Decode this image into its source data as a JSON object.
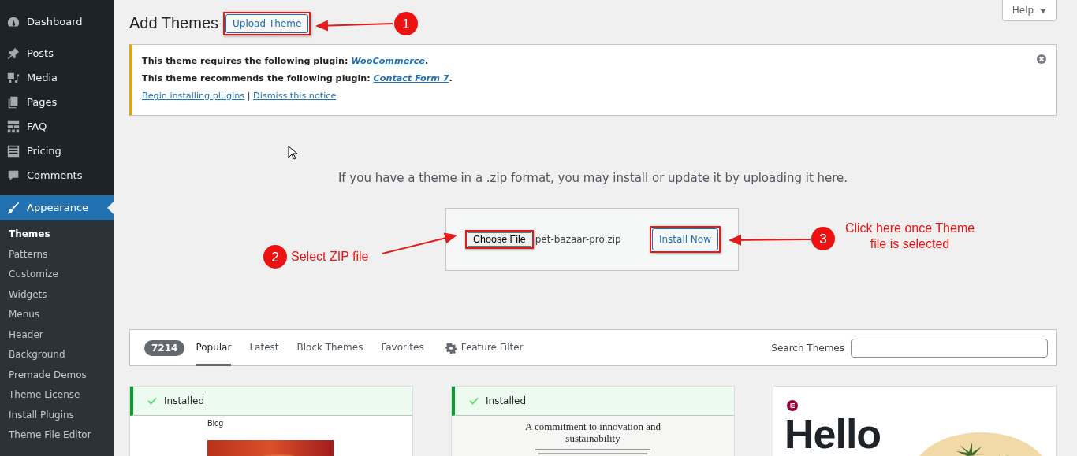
{
  "sidebar": {
    "items": [
      {
        "label": "Dashboard",
        "kind": "gauge",
        "selected": false
      },
      {
        "label": "Posts",
        "kind": "pin",
        "selected": false
      },
      {
        "label": "Media",
        "kind": "media",
        "selected": false
      },
      {
        "label": "Pages",
        "kind": "pages",
        "selected": false
      },
      {
        "label": "FAQ",
        "kind": "grid",
        "selected": false
      },
      {
        "label": "Pricing",
        "kind": "list",
        "selected": false
      },
      {
        "label": "Comments",
        "kind": "bubble",
        "selected": false
      },
      {
        "label": "Appearance",
        "kind": "brush",
        "selected": true
      }
    ],
    "submenu": [
      {
        "label": "Themes",
        "selected": true
      },
      {
        "label": "Patterns",
        "selected": false
      },
      {
        "label": "Customize",
        "selected": false
      },
      {
        "label": "Widgets",
        "selected": false
      },
      {
        "label": "Menus",
        "selected": false
      },
      {
        "label": "Header",
        "selected": false
      },
      {
        "label": "Background",
        "selected": false
      },
      {
        "label": "Premade Demos",
        "selected": false
      },
      {
        "label": "Theme License",
        "selected": false
      },
      {
        "label": "Install Plugins",
        "selected": false
      },
      {
        "label": "Theme File Editor",
        "selected": false
      }
    ]
  },
  "help_button": "Help",
  "page_title": "Add Themes",
  "upload_button": "Upload Theme",
  "notice": {
    "lines": [
      {
        "text": "This theme requires the following plugin: ",
        "link": "WooCommerce",
        "after": "."
      },
      {
        "text": "This theme recommends the following plugin: ",
        "link": "Contact Form 7",
        "after": "."
      }
    ],
    "actions": [
      "Begin installing plugins",
      "Dismiss this notice"
    ],
    "separator": "|"
  },
  "upload": {
    "hint": "If you have a theme in a .zip format, you may install or update it by uploading it here.",
    "choose_button": "Choose File",
    "file_name": "pet-bazaar-pro.zip",
    "install_button": "Install Now"
  },
  "filter_bar": {
    "count": "7214",
    "tabs": [
      {
        "label": "Popular",
        "selected": true,
        "kind": "tab"
      },
      {
        "label": "Latest",
        "selected": false,
        "kind": "tab"
      },
      {
        "label": "Block Themes",
        "selected": false,
        "kind": "tab"
      },
      {
        "label": "Favorites",
        "selected": false,
        "kind": "tab"
      },
      {
        "label": "Feature Filter",
        "selected": false,
        "kind": "filter"
      }
    ],
    "search_label": "Search Themes"
  },
  "themes": [
    {
      "installed": true,
      "status": "Installed",
      "preview": {
        "kind": "blog",
        "heading": "Blog"
      }
    },
    {
      "installed": true,
      "status": "Installed",
      "preview": {
        "kind": "business",
        "heading": "A commitment to innovation and sustainability"
      }
    },
    {
      "installed": false,
      "preview": {
        "kind": "hello",
        "heading": "Hello"
      }
    }
  ],
  "annotations": [
    {
      "number": "1"
    },
    {
      "number": "2",
      "label": "Select ZIP file"
    },
    {
      "number": "3",
      "label": "Click here once Theme file is selected"
    }
  ]
}
